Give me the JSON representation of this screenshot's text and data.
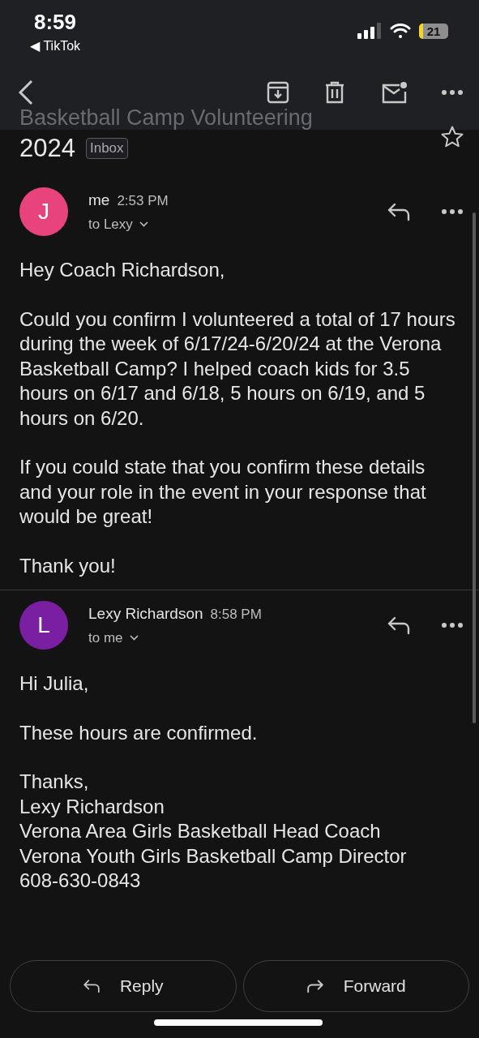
{
  "status_bar": {
    "time": "8:59",
    "back_app": "◀ TikTok",
    "battery": "21"
  },
  "subject": {
    "first_line": "Basketball Camp Volunteering",
    "second_line": "2024",
    "label": "Inbox",
    "starred": false
  },
  "messages": [
    {
      "avatar": "J",
      "color": "#e8437d",
      "sender": "me",
      "time": "2:53 PM",
      "recipient": "to Lexy",
      "paragraphs": [
        [
          "Hey Coach Richardson,"
        ],
        [
          "Could you confirm I volunteered a total of 17 hours during the week of 6/17/24-6/20/24 at the Verona Basketball Camp? I helped coach kids for 3.5 hours on 6/17 and 6/18, 5 hours on 6/19, and 5 hours on 6/20."
        ],
        [
          "If you could state that you confirm these details and your role in the event in your response that would be great!"
        ],
        [
          "Thank you!"
        ]
      ]
    },
    {
      "avatar": "L",
      "color": "#7b1fa2",
      "sender": "Lexy Richardson",
      "time": "8:58 PM",
      "recipient": "to me",
      "paragraphs": [
        [
          "Hi Julia,"
        ],
        [
          "These hours are confirmed."
        ],
        [
          "Thanks,",
          "Lexy Richardson",
          "Verona Area Girls Basketball Head Coach",
          "Verona Youth Girls Basketball Camp Director",
          "608-630-0843"
        ]
      ]
    }
  ],
  "actions": [
    "Reply",
    "Forward"
  ]
}
